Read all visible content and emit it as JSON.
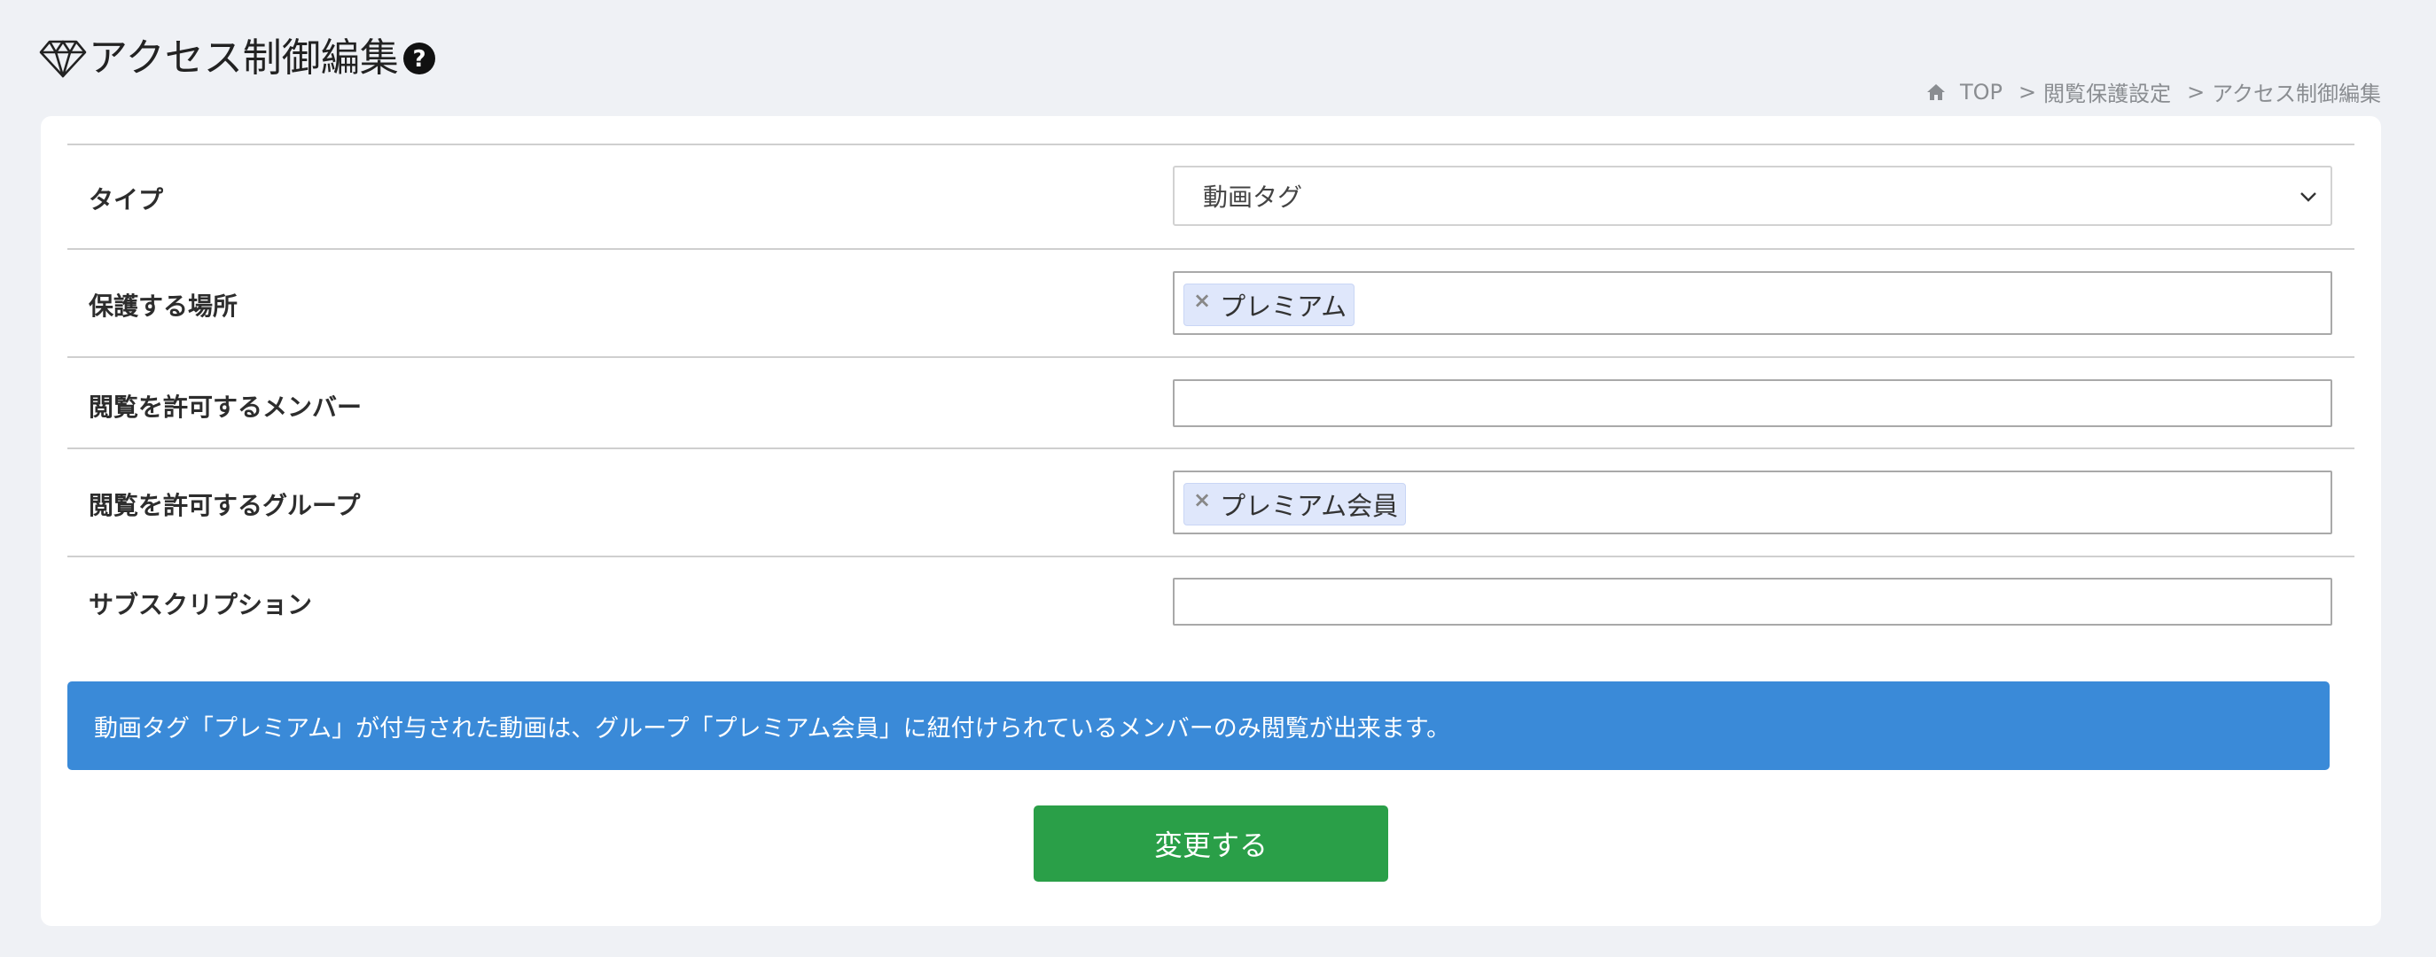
{
  "header": {
    "title": "アクセス制御編集",
    "title_icon": "diamond-icon",
    "help_icon": "question-circle-icon"
  },
  "breadcrumb": {
    "home_icon": "home-icon",
    "items": [
      "TOP",
      "閲覧保護設定",
      "アクセス制御編集"
    ],
    "separator": ">"
  },
  "form": {
    "rows": [
      {
        "label": "タイプ",
        "type": "select",
        "value": "動画タグ"
      },
      {
        "label": "保護する場所",
        "type": "multi-select",
        "tags": [
          "プレミアム"
        ]
      },
      {
        "label": "閲覧を許可するメンバー",
        "type": "multi-select",
        "tags": []
      },
      {
        "label": "閲覧を許可するグループ",
        "type": "multi-select",
        "tags": [
          "プレミアム会員"
        ]
      },
      {
        "label": "サブスクリプション",
        "type": "multi-select",
        "tags": []
      }
    ],
    "tag_remove_symbol": "×"
  },
  "notice": {
    "text": "動画タグ「プレミアム」が付与された動画は、グループ「プレミアム会員」に紐付けられているメンバーのみ閲覧が出来ます。"
  },
  "submit": {
    "label": "変更する"
  },
  "colors": {
    "background": "#eff1f5",
    "notice": "#3a8ad8",
    "submit": "#2a9f48",
    "tag": "#dfe7fb"
  }
}
